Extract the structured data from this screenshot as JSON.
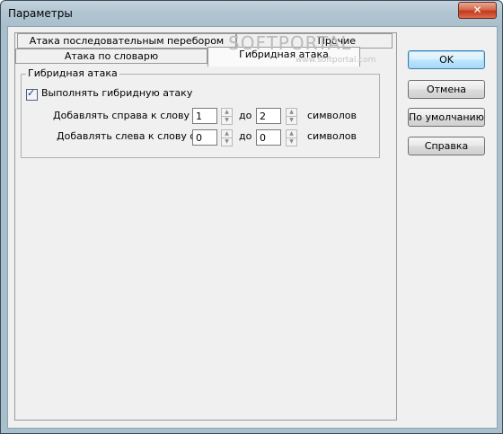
{
  "window": {
    "title": "Параметры",
    "close_glyph": "✕"
  },
  "tabs": {
    "row1": [
      {
        "label": "Атака последовательным перебором"
      },
      {
        "label": "Прочие"
      }
    ],
    "row2": [
      {
        "label": "Атака по словарю"
      },
      {
        "label": "Гибридная атака"
      }
    ],
    "active": "Гибридная атака"
  },
  "hybrid": {
    "group_label": "Гибридная атака",
    "enable_label": "Выполнять гибридную атаку",
    "enabled": true,
    "right_label": "Добавлять справа к слову от",
    "right_from": "1",
    "right_to_label": "до",
    "right_to": "2",
    "right_unit": "символов",
    "left_label": "Добавлять слева к слову от",
    "left_from": "0",
    "left_to_label": "до",
    "left_to": "0",
    "left_unit": "символов"
  },
  "buttons": {
    "ok": "OK",
    "cancel": "Отмена",
    "defaults": "По умолчанию",
    "help": "Справка"
  },
  "watermark": {
    "text": "SOFTPORTAL",
    "sub": "www.softportal.com"
  },
  "icons": {
    "check": "✓",
    "spin_up": "▲",
    "spin_down": "▼"
  }
}
